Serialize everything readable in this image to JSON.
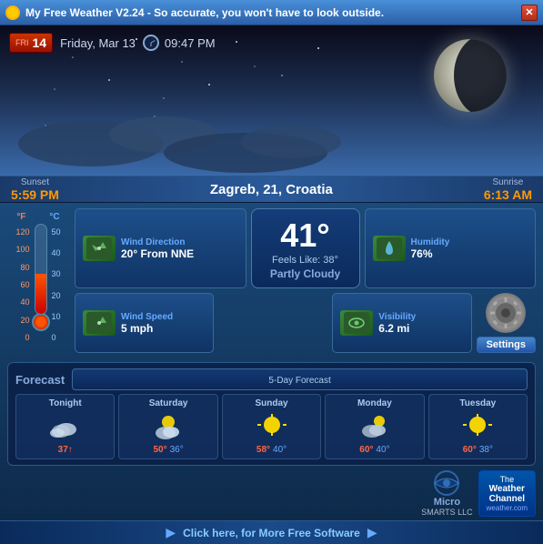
{
  "app": {
    "title": "My Free Weather V2.24  -  So accurate, you won't have to look outside.",
    "close_label": "✕"
  },
  "date": {
    "day_num": "14",
    "day_abbr": "FRI",
    "full_date": "Friday, Mar 13",
    "time": "09:47 PM"
  },
  "location": {
    "city": "Zagreb, 21, Croatia"
  },
  "sun": {
    "sunset_label": "Sunset",
    "sunset_time": "5:59 PM",
    "sunrise_label": "Sunrise",
    "sunrise_time": "6:13 AM"
  },
  "weather": {
    "temperature": "41°",
    "feels_like": "Feels Like: 38°",
    "description": "Partly Cloudy",
    "wind_direction_label": "Wind Direction",
    "wind_direction_value": "20° From NNE",
    "wind_speed_label": "Wind Speed",
    "wind_speed_value": "5 mph",
    "humidity_label": "Humidity",
    "humidity_value": "76%",
    "visibility_label": "Visibility",
    "visibility_value": "6.2 mi",
    "settings_label": "Settings"
  },
  "thermometer": {
    "f_label": "°F",
    "c_label": "°C",
    "f_scale": [
      "120",
      "100",
      "80",
      "60",
      "40",
      "20",
      "0"
    ],
    "c_scale": [
      "50",
      "40",
      "30",
      "20",
      "10",
      "0"
    ]
  },
  "forecast": {
    "title": "Forecast",
    "subtitle": "5-Day Forecast",
    "days": [
      {
        "name": "Tonight",
        "hi": "",
        "lo": "37↑",
        "icon": "🌙"
      },
      {
        "name": "Saturday",
        "hi": "50°",
        "lo": "36°",
        "icon": "⛅"
      },
      {
        "name": "Sunday",
        "hi": "58°",
        "lo": "40°",
        "icon": "☀️"
      },
      {
        "name": "Monday",
        "hi": "60°",
        "lo": "40°",
        "icon": "🌤"
      },
      {
        "name": "Tuesday",
        "hi": "60°",
        "lo": "38°",
        "icon": "☀️"
      }
    ]
  },
  "branding": {
    "micro_line1": "Micro",
    "micro_line2": "SMARTS LLC",
    "wc_the": "The",
    "wc_weather": "Weather",
    "wc_channel": "Channel",
    "wc_url": "weather.com"
  },
  "bottom_bar": {
    "text": "Click here, for More Free Software"
  },
  "colors": {
    "accent_blue": "#3a7acc",
    "sunset_orange": "#ff9900",
    "hi_temp": "#ff6644",
    "lo_temp": "#6699ff"
  }
}
